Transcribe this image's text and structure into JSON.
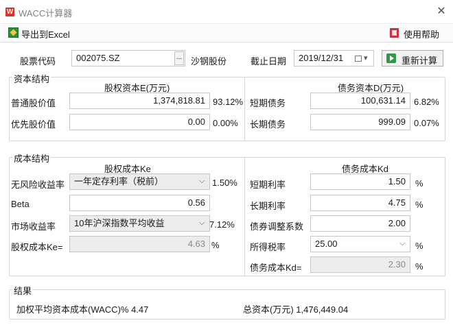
{
  "window": {
    "app_icon_letter": "W",
    "title": "WACC计算器",
    "close_glyph": "✕"
  },
  "toolbar": {
    "export_label": "导出到Excel",
    "help_label": "使用帮助"
  },
  "header": {
    "stock_code_label": "股票代码",
    "stock_code_value": "002075.SZ",
    "browse_glyph": "...",
    "stock_name": "沙钢股份",
    "date_label": "截止日期",
    "date_value": "2019/12/31",
    "recalc_label": "重新计算"
  },
  "capital_structure": {
    "title": "资本结构",
    "equity_header": "股权资本E(万元)",
    "debt_header": "债务资本D(万元)",
    "rows_left": [
      {
        "label": "普通股价值",
        "value": "1,374,818.81",
        "pct": "93.12%"
      },
      {
        "label": "优先股价值",
        "value": "0.00",
        "pct": "0.00%"
      }
    ],
    "rows_right": [
      {
        "label": "短期债务",
        "value": "100,631.14",
        "pct": "6.82%"
      },
      {
        "label": "长期债务",
        "value": "999.09",
        "pct": "0.07%"
      }
    ]
  },
  "cost_structure": {
    "title": "成本结构",
    "equity_header": "股权成本Ke",
    "debt_header": "债务成本Kd",
    "risk_free_label": "无风险收益率",
    "risk_free_option": "一年定存利率（税前）",
    "risk_free_pct": "1.50%",
    "beta_label": "Beta",
    "beta_value": "0.56",
    "market_label": "市场收益率",
    "market_option": "10年沪深指数平均收益",
    "market_pct": "7.12%",
    "ke_label": "股权成本Ke=",
    "ke_value": "4.63",
    "ke_unit": "%",
    "short_rate_label": "短期利率",
    "short_rate_value": "1.50",
    "long_rate_label": "长期利率",
    "long_rate_value": "4.75",
    "debt_adj_label": "债券调整系数",
    "debt_adj_value": "2.00",
    "tax_label": "所得税率",
    "tax_value": "25.00",
    "kd_label": "债务成本Kd=",
    "kd_value": "2.30",
    "unit": "%"
  },
  "result": {
    "title": "结果",
    "wacc_text": "加权平均资本成本(WACC)% 4.47",
    "total_capital_text": "总资本(万元) 1,476,449.04"
  },
  "colors": {
    "accent_green": "#2e9a47",
    "app_red": "#d8332a",
    "border": "#c6c6c6",
    "disabled_bg": "#ececec"
  },
  "icons": {
    "export": "excel-export-icon",
    "help": "help-book-icon",
    "recalc": "play-icon",
    "calendar": "calendar-icon",
    "dropdown": "chevron-down-icon"
  }
}
